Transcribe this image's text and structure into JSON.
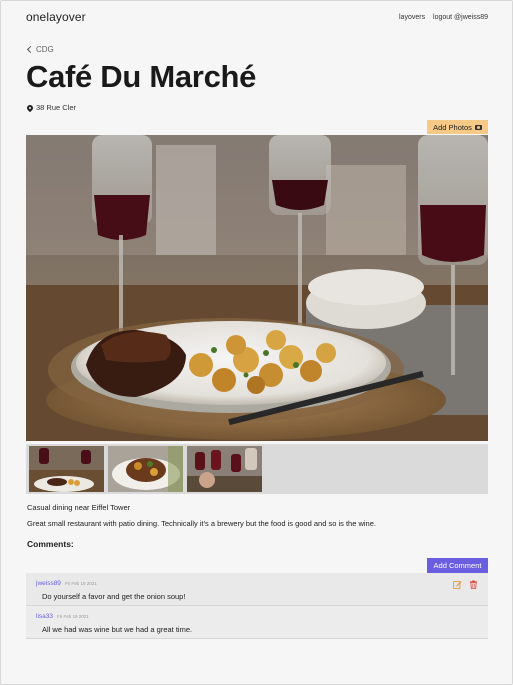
{
  "header": {
    "brand": "onelayover",
    "nav_layovers": "layovers",
    "nav_logout": "logout @jweiss89"
  },
  "back_link": "CDG",
  "place": {
    "title": "Café Du Marché",
    "address": "38 Rue Cler",
    "add_photos_label": "Add Photos",
    "short_description": "Casual dining near Eiffel Tower",
    "long_description": "Great small restaurant with patio dining. Technically it's a brewery but the food is good and so is the wine."
  },
  "comments": {
    "heading": "Comments:",
    "add_label": "Add Comment",
    "items": [
      {
        "author": "jweiss89",
        "date": "Fri Feb 19 2021",
        "text": "Do yourself a favor and get the onion soup!"
      },
      {
        "author": "lisa33",
        "date": "Fri Feb 19 2021",
        "text": "All we had was wine but we had a great time."
      }
    ]
  },
  "colors": {
    "accent_purple": "#6a5ee0",
    "add_photos_orange": "#f7c986",
    "edit_icon": "#e0902a",
    "delete_icon": "#d8453a"
  },
  "icons": [
    "chevron-left-icon",
    "map-marker-icon",
    "camera-icon",
    "edit-icon",
    "trash-icon"
  ]
}
